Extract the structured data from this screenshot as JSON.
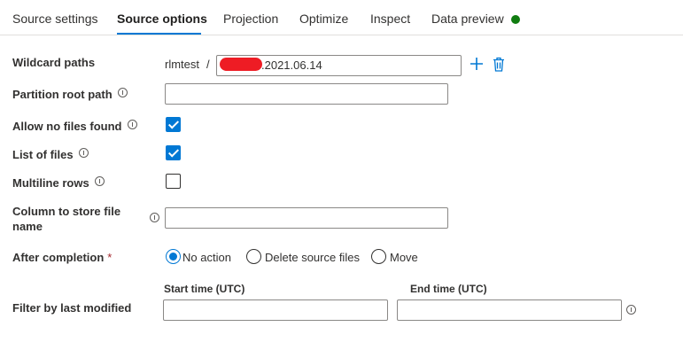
{
  "tabs": [
    {
      "label": "Source settings"
    },
    {
      "label": "Source options"
    },
    {
      "label": "Projection"
    },
    {
      "label": "Optimize"
    },
    {
      "label": "Inspect"
    },
    {
      "label": "Data preview"
    }
  ],
  "active_tab": "Source options",
  "data_preview_status_color": "#107c10",
  "accent_color": "#0078d4",
  "wildcard_paths": {
    "label": "Wildcard paths",
    "prefix": "rlmtest",
    "separator": "/",
    "value": ".2021.06.14",
    "add_icon": "plus-icon",
    "delete_icon": "trash-icon"
  },
  "partition_root_path": {
    "label": "Partition root path",
    "value": ""
  },
  "allow_no_files_found": {
    "label": "Allow no files found",
    "checked": true
  },
  "list_of_files": {
    "label": "List of files",
    "checked": true
  },
  "multiline_rows": {
    "label": "Multiline rows",
    "checked": false
  },
  "column_to_store_file_name": {
    "label_line1": "Column to store file",
    "label_line2": "name",
    "value": ""
  },
  "after_completion": {
    "label": "After completion",
    "required_marker": "*",
    "options": [
      "No action",
      "Delete source files",
      "Move"
    ],
    "selected": "No action"
  },
  "filter_by_last_modified": {
    "label": "Filter by last modified",
    "start_label": "Start time (UTC)",
    "end_label": "End time (UTC)",
    "start_value": "",
    "end_value": ""
  }
}
